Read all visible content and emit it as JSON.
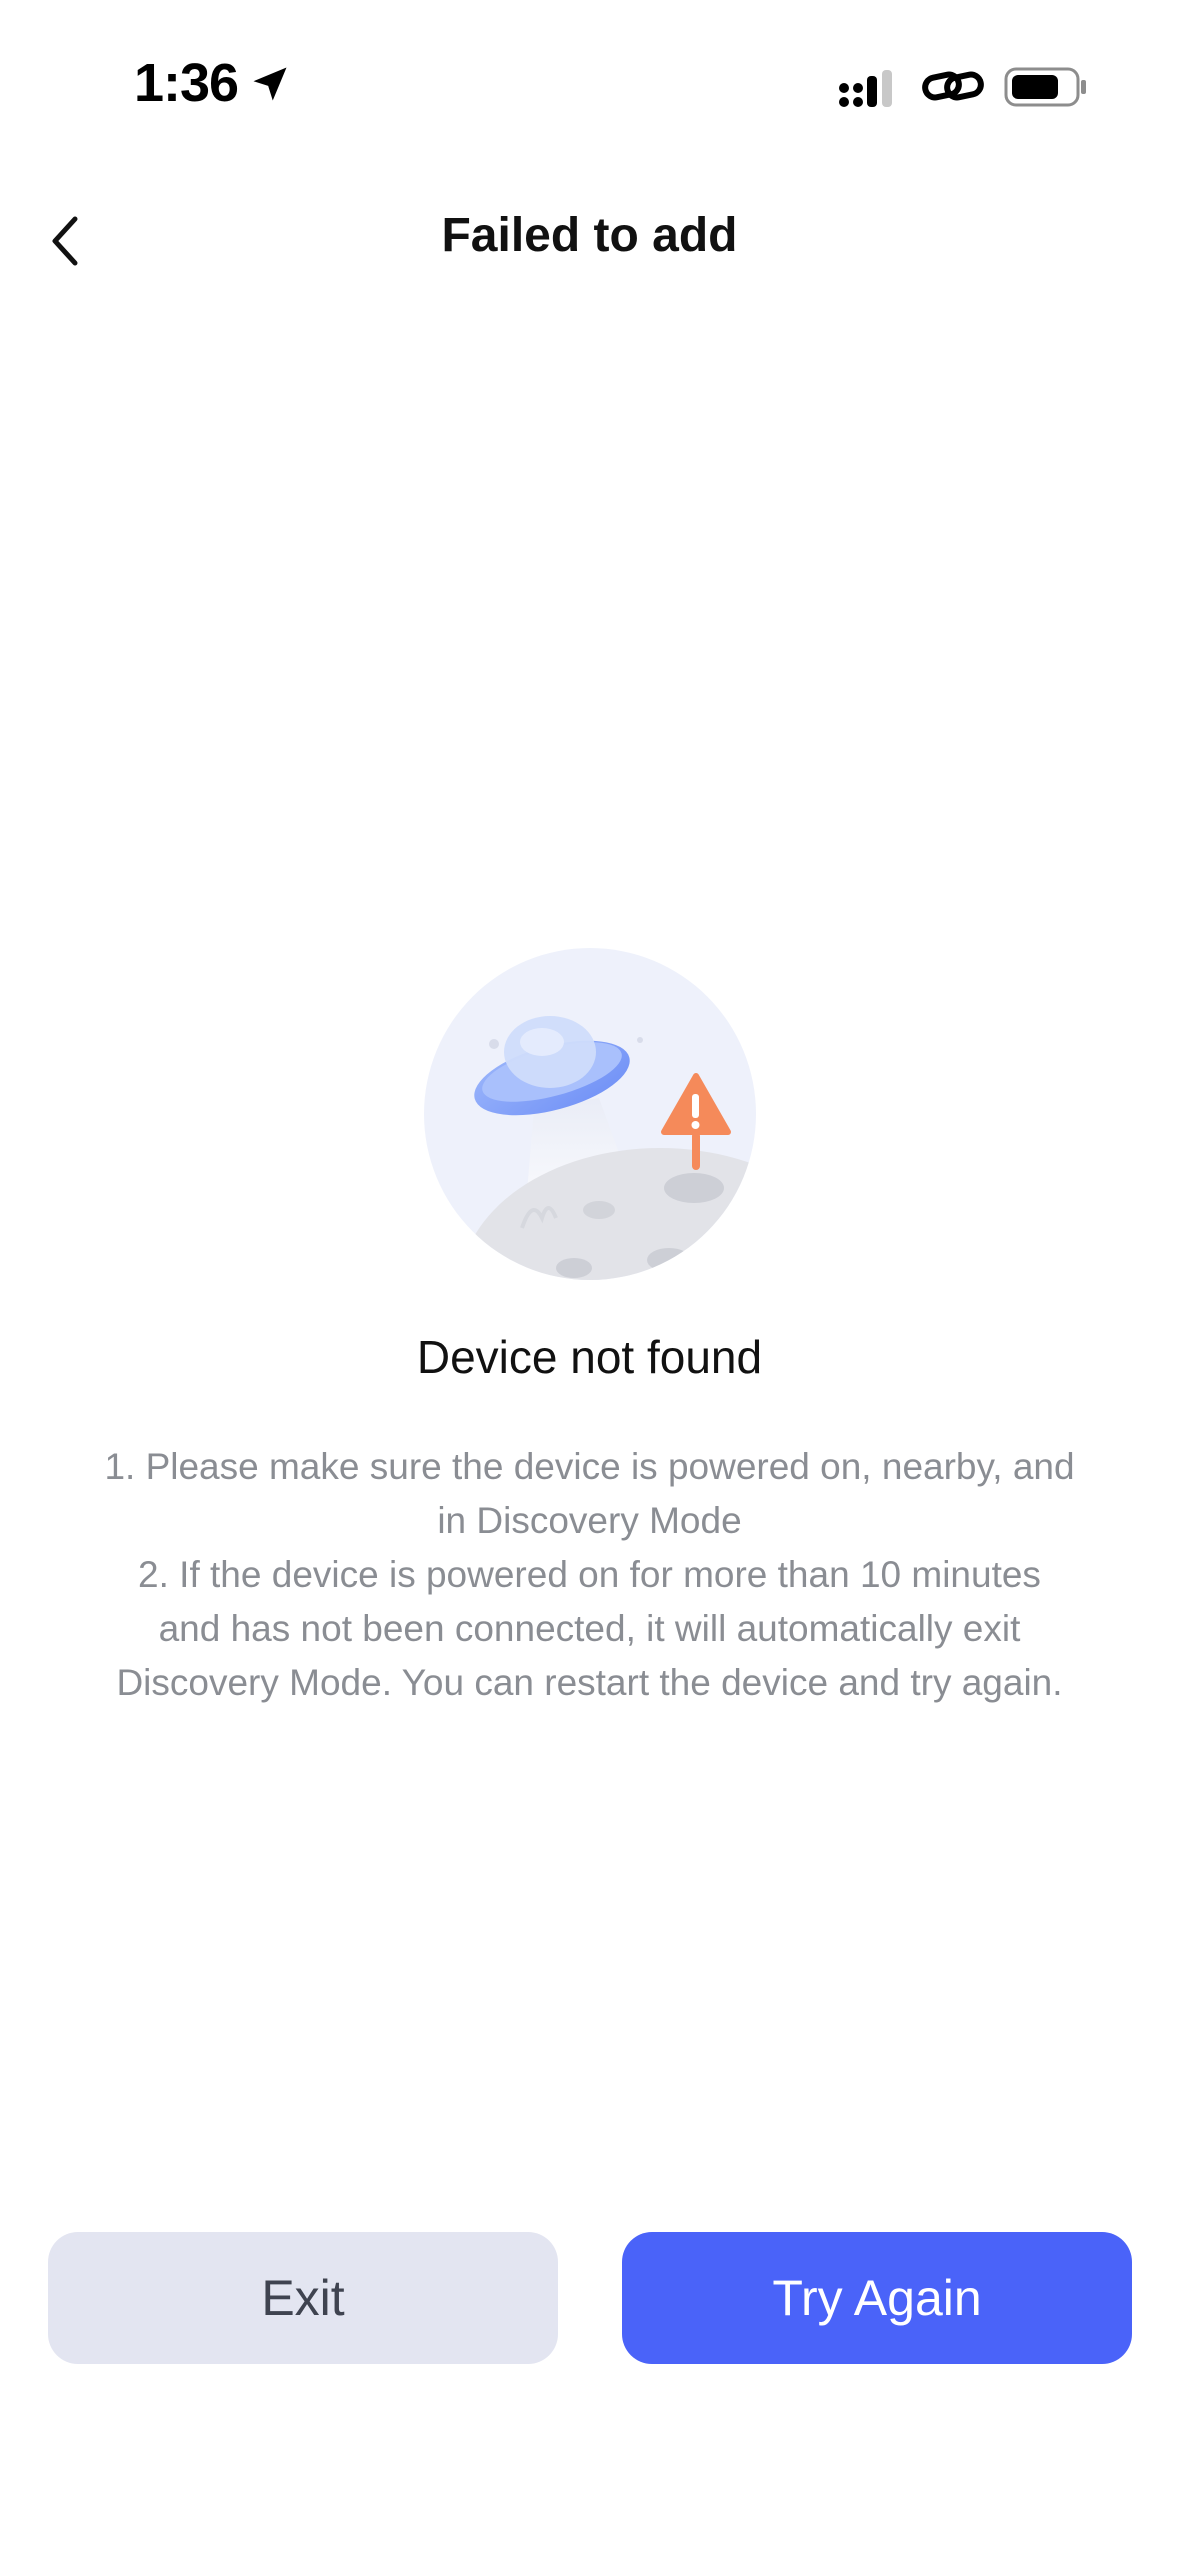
{
  "status_bar": {
    "time": "1:36"
  },
  "nav": {
    "title": "Failed to add"
  },
  "message": {
    "title": "Device not found",
    "lines": [
      "1. Please make sure the device is powered on, nearby, and",
      "in Discovery Mode",
      "2. If the device is powered on for more than 10 minutes",
      "and has not been connected, it will automatically exit",
      "Discovery Mode. You can restart the device and try again."
    ]
  },
  "buttons": {
    "exit_label": "Exit",
    "try_again_label": "Try Again"
  },
  "colors": {
    "primary": "#4a63f9",
    "secondary_button_bg": "#e3e5f1",
    "body_text": "#8a8d93",
    "warning": "#f58a5a"
  },
  "icons": {
    "back": "chevron-left-icon",
    "location": "location-arrow-icon",
    "signal": "cellular-signal-icon",
    "link": "link-icon",
    "battery": "battery-icon",
    "illustration": "ufo-warning-illustration"
  }
}
